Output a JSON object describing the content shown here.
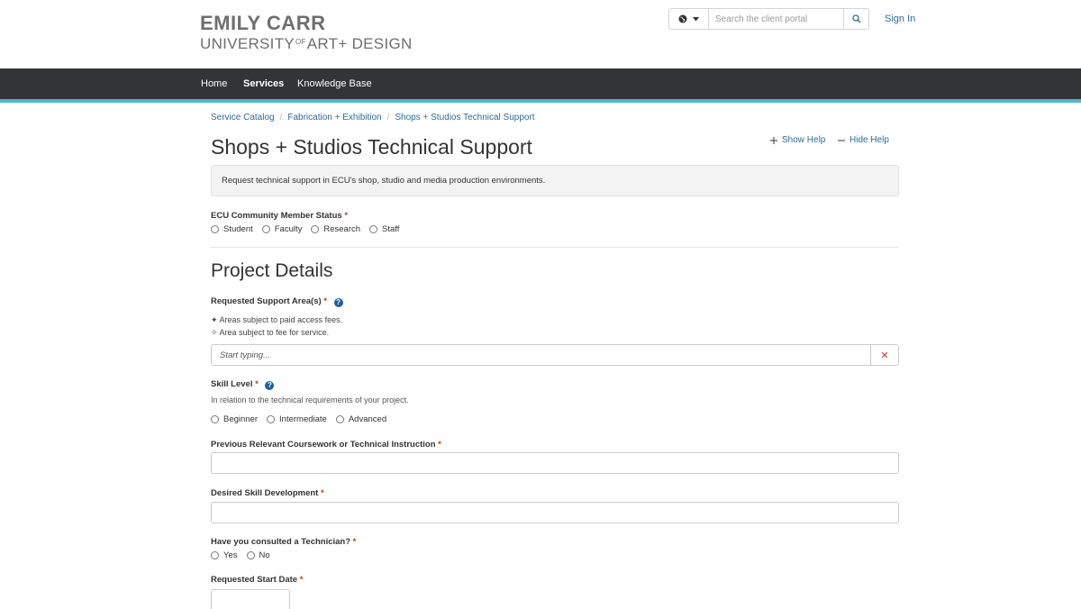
{
  "brand": {
    "line1": "EMILY CARR",
    "line2_a": "UNIVERSITY",
    "line2_of": "OF",
    "line2_b": "ART+ DESIGN"
  },
  "header": {
    "search_placeholder": "Search the client portal",
    "sign_in": "Sign In",
    "icons": [
      "globe-icon",
      "caret-down-icon",
      "search-icon"
    ]
  },
  "nav": {
    "items": [
      {
        "label": "Home",
        "active": false
      },
      {
        "label": "Services",
        "active": true
      },
      {
        "label": "Knowledge Base",
        "active": false
      }
    ]
  },
  "breadcrumb": [
    "Service Catalog",
    "Fabrication + Exhibition",
    "Shops + Studios Technical Support"
  ],
  "page": {
    "title": "Shops + Studios Technical Support",
    "show_help": "Show Help",
    "hide_help": "Hide Help",
    "description": "Request technical support in ECU's shop, studio and media production environments."
  },
  "form": {
    "member_status": {
      "label": "ECU Community Member Status",
      "required_mark": "*",
      "options": [
        "Student",
        "Faculty",
        "Research",
        "Staff"
      ]
    },
    "section_title": "Project Details",
    "support_areas": {
      "label": "Requested Support Area(s)",
      "required_mark": "*",
      "note1": "✦ Areas subject to paid access fees.",
      "note2": "✧ Area subject to fee for service.",
      "placeholder": "Start typing...",
      "clear_glyph": "✕"
    },
    "skill_level": {
      "label": "Skill Level",
      "required_mark": "*",
      "hint": "In relation to the technical requirements of your project.",
      "options": [
        "Beginner",
        "Intermediate",
        "Advanced"
      ]
    },
    "previous_coursework": {
      "label": "Previous Relevant Coursework or Technical Instruction",
      "required_mark": "*",
      "value": ""
    },
    "desired_skill": {
      "label": "Desired Skill Development",
      "required_mark": "*",
      "value": ""
    },
    "consulted": {
      "label": "Have you consulted a Technician?",
      "required_mark": "*",
      "options": [
        "Yes",
        "No"
      ]
    },
    "start_date": {
      "label": "Requested Start Date",
      "required_mark": "*",
      "value": ""
    }
  },
  "colors": {
    "nav_bg": "#333436",
    "nav_accent": "#4bb8be",
    "link": "#2d6b9a",
    "required": "#c0392b",
    "help_icon": "#1f5f99"
  }
}
